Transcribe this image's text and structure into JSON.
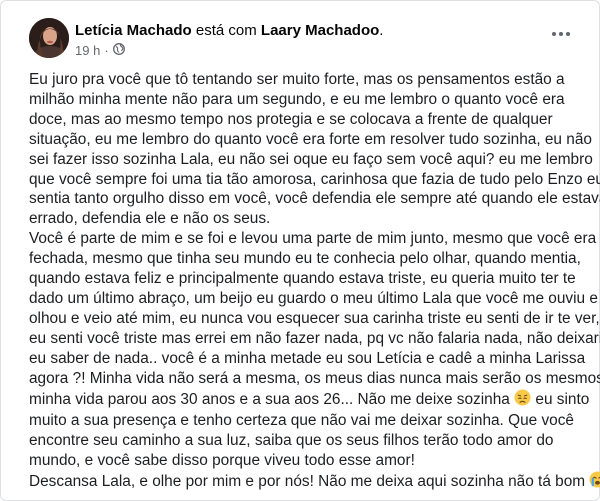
{
  "post": {
    "author": "Letícia Machado",
    "with_text": "está com",
    "tagged": "Laary Machadoo",
    "tagged_suffix": ".",
    "timestamp": "19 h",
    "dot": "·",
    "audience_icon": "globe-icon",
    "menu_icon": "more-horizontal-icon"
  },
  "content": {
    "p1": [
      "Eu juro pra você que tô tentando ser muito forte, mas os pensamentos estão a",
      "milhão minha mente não para um segundo, e eu me lembro o quanto você era",
      "doce, mas ao mesmo tempo nos protegia e se colocava a frente de qualquer",
      "situação, eu me lembro do quanto você era forte em resolver tudo sozinha, eu não",
      "sei fazer isso sozinha Lala, eu não sei oque eu faço sem você aqui? eu me lembro",
      "que você sempre foi uma tia tão amorosa, carinhosa que fazia de tudo pelo Enzo eu",
      "sentia tanto orgulho disso em você, você defendia ele sempre até quando ele estava",
      "errado, defendia ele e não os seus."
    ],
    "p2": [
      "Você é parte de mim e se foi e levou uma parte de mim junto, mesmo que você era",
      "fechada, mesmo que tinha seu mundo eu te conhecia pelo olhar, quando mentia,",
      "quando estava feliz e principalmente quando estava triste, eu queria muito ter te",
      "dado um último abraço, um beijo eu guardo o meu último Lala que você me ouviu e",
      "olhou e veio até mim, eu nunca vou esquecer sua carinha triste eu senti de ir te ver,",
      "eu senti você triste mas errei em não fazer nada, pq vc não falaria nada, não deixaria",
      "eu saber de nada.. você é a minha metade eu sou Letícia e cadê a minha Larissa",
      "agora ?! Minha vida não será a mesma, os meus dias nunca mais serão os mesmos,"
    ],
    "p2_line9_before_emoji": "minha vida parou aos 30 anos e a sua aos 26... Não me deixe sozinha",
    "p2_line9_after_emoji": "eu sinto",
    "p2_rest": [
      "muito a sua presença e tenho certeza que não vai me deixar sozinha. Que você",
      "encontre seu caminho a sua luz, saiba que os seus filhos terão todo amor do",
      "mundo, e você sabe disso porque viveu todo esse amor!"
    ],
    "p3": "Descansa Lala, e olhe por mim e por nós! Não me deixa aqui sozinha não tá bom",
    "emoji_disappointed": "disappointed-face-emoji",
    "emoji_crying": "crying-face-emoji"
  }
}
